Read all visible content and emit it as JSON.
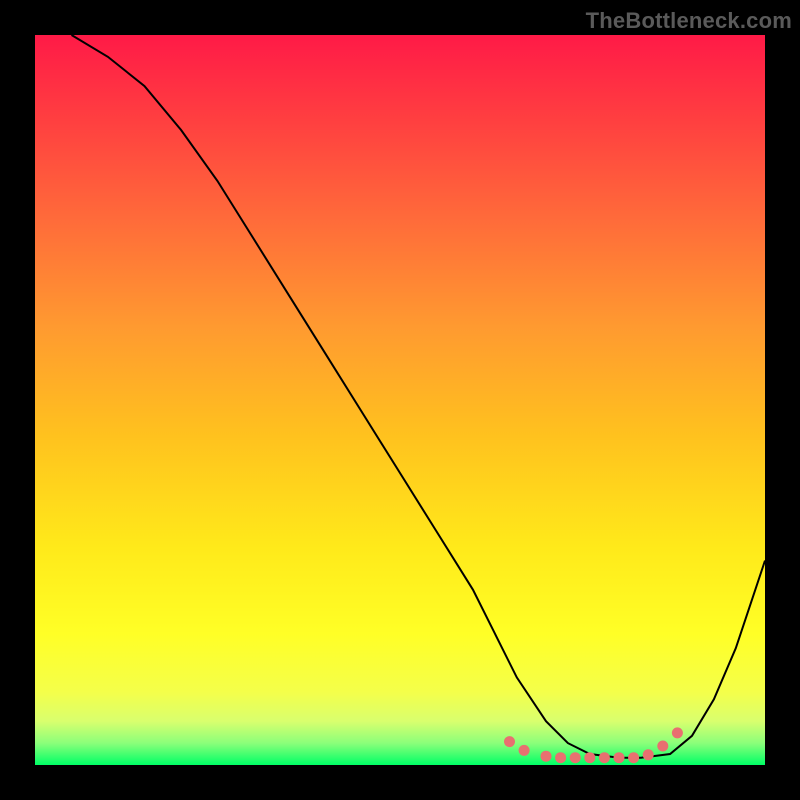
{
  "watermark": "TheBottleneck.com",
  "colors": {
    "page_bg": "#000000",
    "gradient_top": "#ff1a47",
    "gradient_bottom": "#00ff66",
    "curve_stroke": "#000000",
    "dot_fill": "#e87070",
    "watermark_text": "#5a5a5a"
  },
  "chart_data": {
    "type": "line",
    "title": "",
    "xlabel": "",
    "ylabel": "",
    "xlim": [
      0,
      100
    ],
    "ylim": [
      0,
      100
    ],
    "grid": false,
    "legend": false,
    "series": [
      {
        "name": "curve",
        "x": [
          5,
          10,
          15,
          20,
          25,
          30,
          35,
          40,
          45,
          50,
          55,
          60,
          63,
          66,
          70,
          73,
          76,
          80,
          83,
          87,
          90,
          93,
          96,
          100
        ],
        "y": [
          100,
          97,
          93,
          87,
          80,
          72,
          64,
          56,
          48,
          40,
          32,
          24,
          18,
          12,
          6,
          3,
          1.5,
          1,
          1,
          1.5,
          4,
          9,
          16,
          28
        ]
      }
    ],
    "markers": {
      "name": "valley-dots",
      "x": [
        65,
        67,
        70,
        72,
        74,
        76,
        78,
        80,
        82,
        84,
        86,
        88
      ],
      "y": [
        3.2,
        2.0,
        1.2,
        1.0,
        1.0,
        1.0,
        1.0,
        1.0,
        1.0,
        1.4,
        2.6,
        4.4
      ]
    }
  }
}
